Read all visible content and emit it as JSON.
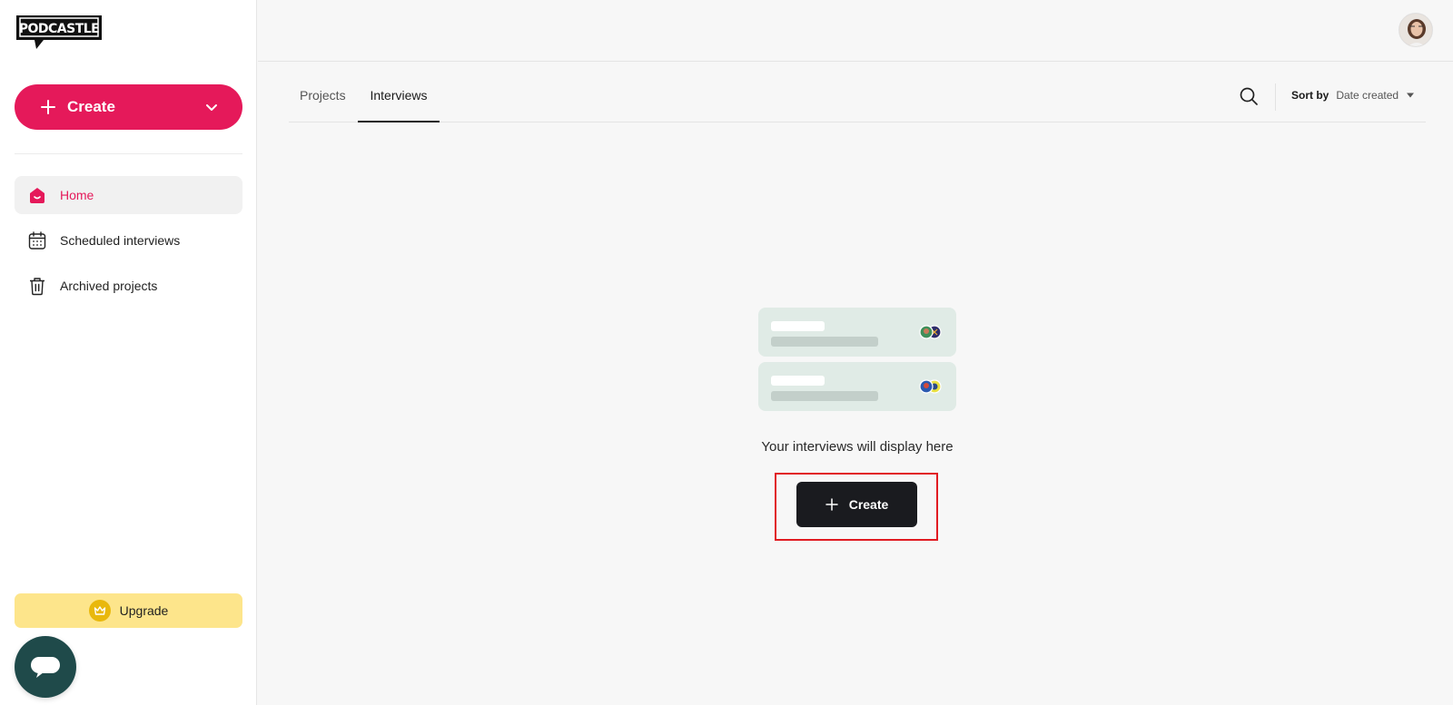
{
  "brand": {
    "logo_text": "PODCASTLE"
  },
  "sidebar": {
    "create_label": "Create",
    "nav": [
      {
        "label": "Home",
        "icon": "home-icon",
        "active": true
      },
      {
        "label": "Scheduled interviews",
        "icon": "calendar-icon",
        "active": false
      },
      {
        "label": "Archived projects",
        "icon": "trash-icon",
        "active": false
      }
    ],
    "upgrade_label": "Upgrade"
  },
  "tabs": {
    "items": [
      {
        "label": "Projects",
        "active": false
      },
      {
        "label": "Interviews",
        "active": true
      }
    ],
    "sort_label": "Sort by",
    "sort_value": "Date created"
  },
  "empty_state": {
    "message": "Your interviews will display here",
    "create_label": "Create"
  },
  "colors": {
    "brand_pink": "#e5195a",
    "upgrade_yellow": "#fde58b",
    "dark_button": "#1a1b1f",
    "highlight_red": "#e11b22",
    "chat_teal": "#1f4a4a"
  }
}
